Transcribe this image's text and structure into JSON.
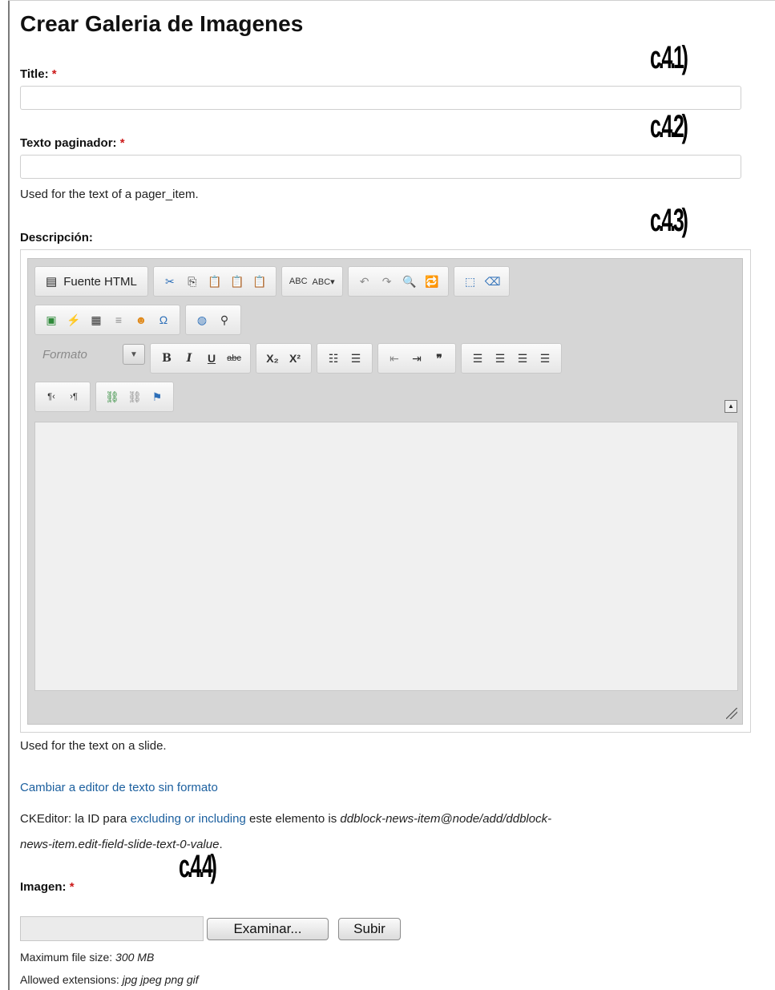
{
  "page": {
    "title": "Crear Galeria de Imagenes"
  },
  "annotations": [
    "c.4.1)",
    "c.4.2)",
    "c.4.3)",
    "c.4.4)"
  ],
  "required_mark": "*",
  "fields": {
    "title": {
      "label": "Title:",
      "value": ""
    },
    "pager_text": {
      "label": "Texto paginador:",
      "value": "",
      "description": "Used for the text of a pager_item."
    },
    "description": {
      "label": "Descripción:",
      "help": "Used for the text on a slide."
    }
  },
  "editor": {
    "source_label": "Fuente HTML",
    "format_label": "Formato",
    "format_arrow": "▼",
    "collapse_glyph": "▲",
    "buttons": {
      "cut": "✂",
      "copy": "⎘",
      "paste": "📋",
      "paste_text": "📋",
      "paste_word": "📋",
      "spell": "ABC",
      "spell_auto": "ABC▾",
      "undo": "↶",
      "redo": "↷",
      "find": "🔍",
      "replace": "🔁",
      "select_all": "⬚",
      "remove_format": "⌫",
      "image": "▣",
      "flash": "⚡",
      "table": "▦",
      "hr": "≡",
      "smiley": "☻",
      "special_char": "Ω",
      "iframe": "◍",
      "preview": "⚲",
      "bold": "B",
      "italic": "I",
      "underline": "U",
      "strike": "abc",
      "subscript": "X₂",
      "superscript": "X²",
      "numbered_list": "☷",
      "bullet_list": "☰",
      "outdent": "⇤",
      "indent": "⇥",
      "blockquote": "❞",
      "align_left": "☰",
      "align_center": "☰",
      "align_right": "☰",
      "justify": "☰",
      "ltr": "¶‹",
      "rtl": "›¶",
      "link": "⛓",
      "unlink": "⛓",
      "anchor": "⚑"
    }
  },
  "links": {
    "toggle_editor": "Cambiar a editor de texto sin formato",
    "ckeditor_prefix": "CKEditor: la ID para ",
    "ckeditor_link": "excluding or including",
    "ckeditor_middle": " este elemento is ",
    "ckeditor_id_line1": "ddblock-news-item@node/add/ddblock-",
    "ckeditor_id_line2": "news-item.edit-field-slide-text-0-value",
    "ckeditor_end": "."
  },
  "image_field": {
    "label": "Imagen:",
    "browse_button": "Examinar...",
    "upload_button": "Subir",
    "max_size_label": "Maximum file size: ",
    "max_size_value": "300 MB",
    "extensions_label": "Allowed extensions: ",
    "extensions_value": "jpg jpeg png gif"
  }
}
